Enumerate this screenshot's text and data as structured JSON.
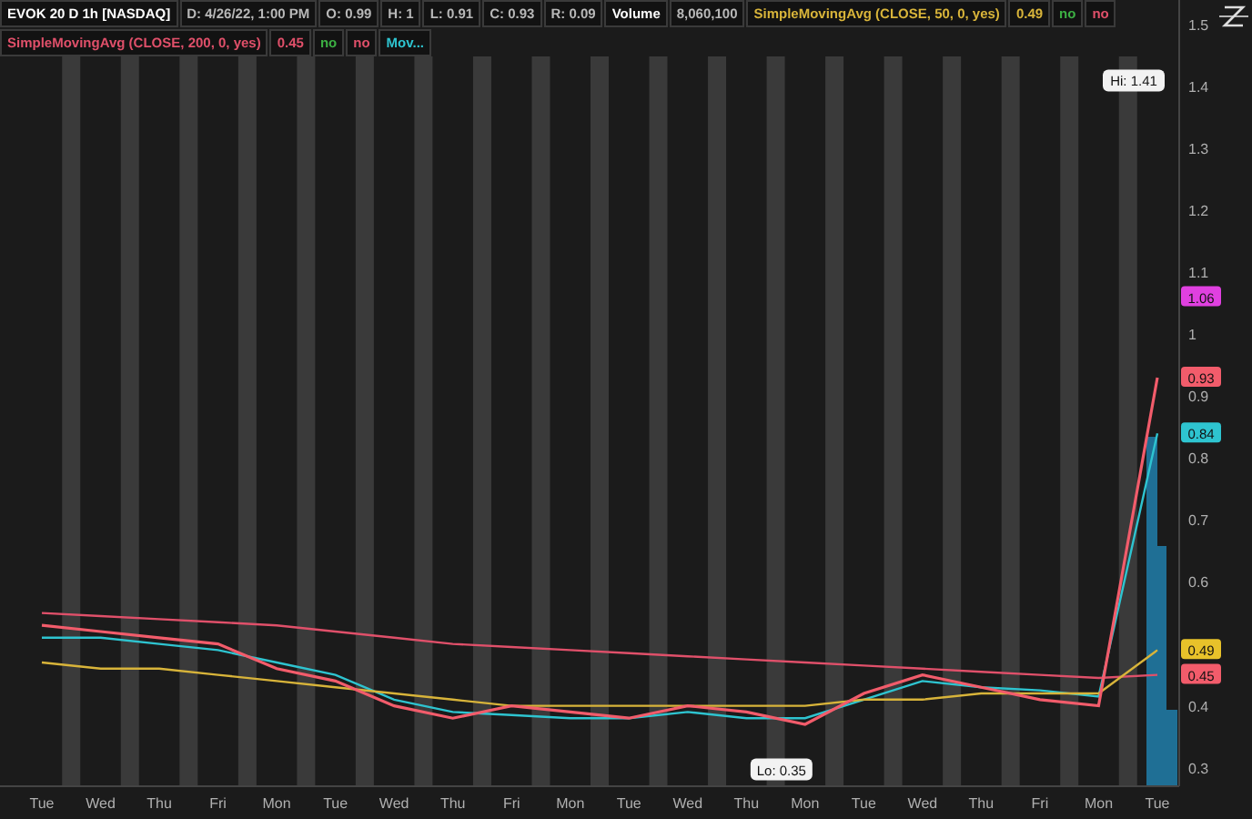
{
  "header": {
    "quote": [
      {
        "text": "D: 4/26/22, 1:00 PM",
        "kind": "field"
      },
      {
        "text": "O: 0.99",
        "kind": "field"
      },
      {
        "text": "H: 1",
        "kind": "field"
      },
      {
        "text": "L: 0.91",
        "kind": "field"
      },
      {
        "text": "C: 0.93",
        "kind": "field"
      },
      {
        "text": "R: 0.09",
        "kind": "field"
      },
      {
        "text": "Volume",
        "kind": "label"
      },
      {
        "text": "8,060,100",
        "kind": "field"
      }
    ],
    "studies": [
      {
        "value": "0.49",
        "flags": [
          {
            "text": "no",
            "color": "#3cb043"
          },
          {
            "text": "no",
            "color": "#e0506a"
          }
        ]
      },
      {
        "value": "0.45",
        "flags": [
          {
            "text": "no",
            "color": "#3cb043"
          },
          {
            "text": "no",
            "color": "#e0506a"
          }
        ]
      }
    ]
  },
  "chart": {
    "chart_data": {
      "type": "line",
      "categories": [
        "Tue",
        "Wed",
        "Thu",
        "Fri",
        "Mon",
        "Tue",
        "Wed",
        "Thu",
        "Fri",
        "Mon",
        "Tue",
        "Wed",
        "Thu",
        "Mon",
        "Tue",
        "Wed",
        "Thu",
        "Fri",
        "Mon",
        "Tue"
      ],
      "series": [
        {
          "name": "EVOK 20 D 1h [NASDAQ]",
          "color": "#f25c6b",
          "values": [
            0.53,
            0.52,
            0.51,
            0.5,
            0.46,
            0.44,
            0.4,
            0.38,
            0.4,
            0.39,
            0.38,
            0.4,
            0.39,
            0.37,
            0.42,
            0.45,
            0.43,
            0.41,
            0.4,
            0.93
          ]
        },
        {
          "name": "SimpleMovingAvg (CLOSE, 50, 0, yes)",
          "color": "#d8b43a",
          "values": [
            0.47,
            0.46,
            0.46,
            0.45,
            0.44,
            0.43,
            0.42,
            0.41,
            0.4,
            0.4,
            0.4,
            0.4,
            0.4,
            0.4,
            0.41,
            0.41,
            0.42,
            0.42,
            0.42,
            0.49
          ]
        },
        {
          "name": "SimpleMovingAvg (CLOSE, 200, 0, yes)",
          "color": "#e0506a",
          "values": [
            0.55,
            0.545,
            0.54,
            0.535,
            0.53,
            0.52,
            0.51,
            0.5,
            0.495,
            0.49,
            0.485,
            0.48,
            0.475,
            0.47,
            0.465,
            0.46,
            0.455,
            0.45,
            0.445,
            0.45
          ]
        },
        {
          "name": "Mov...",
          "color": "#2ec4d0",
          "values": [
            0.51,
            0.51,
            0.5,
            0.49,
            0.47,
            0.45,
            0.41,
            0.39,
            0.385,
            0.38,
            0.38,
            0.39,
            0.38,
            0.38,
            0.41,
            0.44,
            0.43,
            0.425,
            0.415,
            0.84
          ]
        }
      ],
      "ylim": [
        0.27,
        1.54
      ],
      "yticks": [
        0.3,
        0.4,
        0.6,
        0.7,
        0.8,
        0.9,
        1,
        1.1,
        1.2,
        1.3,
        1.4,
        1.5
      ],
      "annotations": [
        {
          "text": "Hi: 1.41"
        },
        {
          "text": "Lo: 0.35"
        }
      ]
    },
    "price_tags": [
      {
        "text": "1.06",
        "color": "#e040e0"
      },
      {
        "text": "0.93",
        "color": "#f25c6b"
      },
      {
        "text": "0.84",
        "color": "#2ec4d0"
      },
      {
        "text": "0.49",
        "color": "#e8c22a"
      },
      {
        "text": "0.45",
        "color": "#f25c6b"
      }
    ]
  }
}
